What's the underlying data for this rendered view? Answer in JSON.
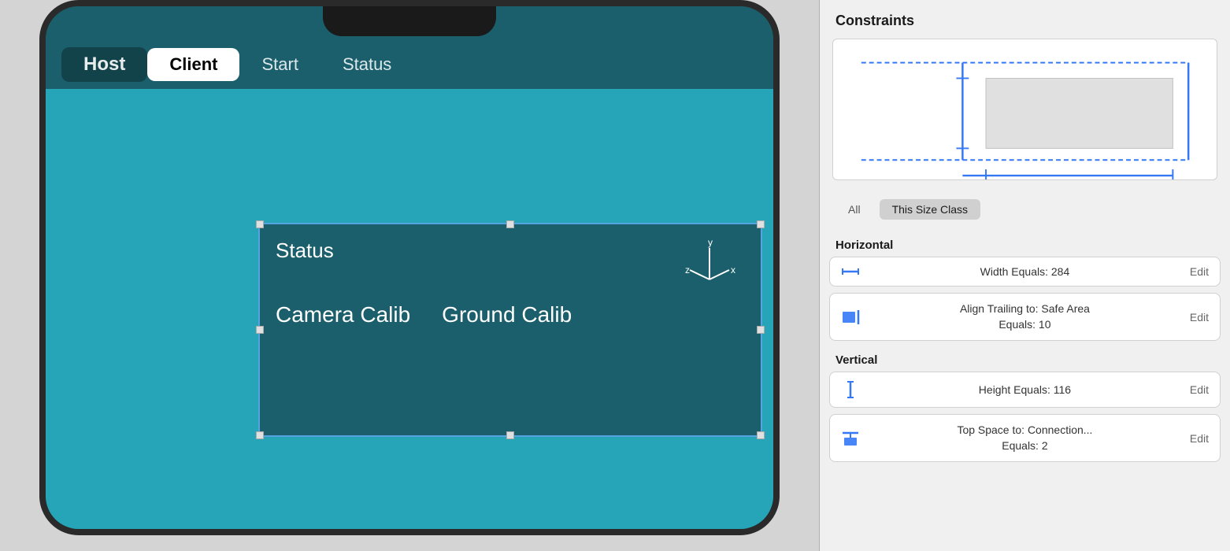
{
  "simulator": {
    "tabs": [
      {
        "label": "Host",
        "active": false,
        "class": "host"
      },
      {
        "label": "Client",
        "active": true,
        "class": "active"
      },
      {
        "label": "Start",
        "active": false,
        "class": ""
      },
      {
        "label": "Status",
        "active": false,
        "class": ""
      }
    ],
    "view_title": "Status",
    "calib_buttons": [
      "Camera Calib",
      "Ground Calib"
    ]
  },
  "constraints": {
    "title": "Constraints",
    "size_class_all": "All",
    "size_class_this": "This Size Class",
    "horizontal_label": "Horizontal",
    "vertical_label": "Vertical",
    "rows": [
      {
        "id": "width",
        "icon": "width-icon",
        "text": "Width Equals:  284",
        "edit": "Edit",
        "two_line": false
      },
      {
        "id": "trailing",
        "icon": "trailing-icon",
        "text_line1": "Align Trailing to:  Safe Area",
        "text_line2": "Equals:  10",
        "edit": "Edit",
        "two_line": true
      },
      {
        "id": "height",
        "icon": "height-icon",
        "text": "Height Equals:  116",
        "edit": "Edit",
        "two_line": false
      },
      {
        "id": "topspace",
        "icon": "topspace-icon",
        "text_line1": "Top Space to:  Connection...",
        "text_line2": "Equals:  2",
        "edit": "Edit",
        "two_line": true
      }
    ]
  }
}
